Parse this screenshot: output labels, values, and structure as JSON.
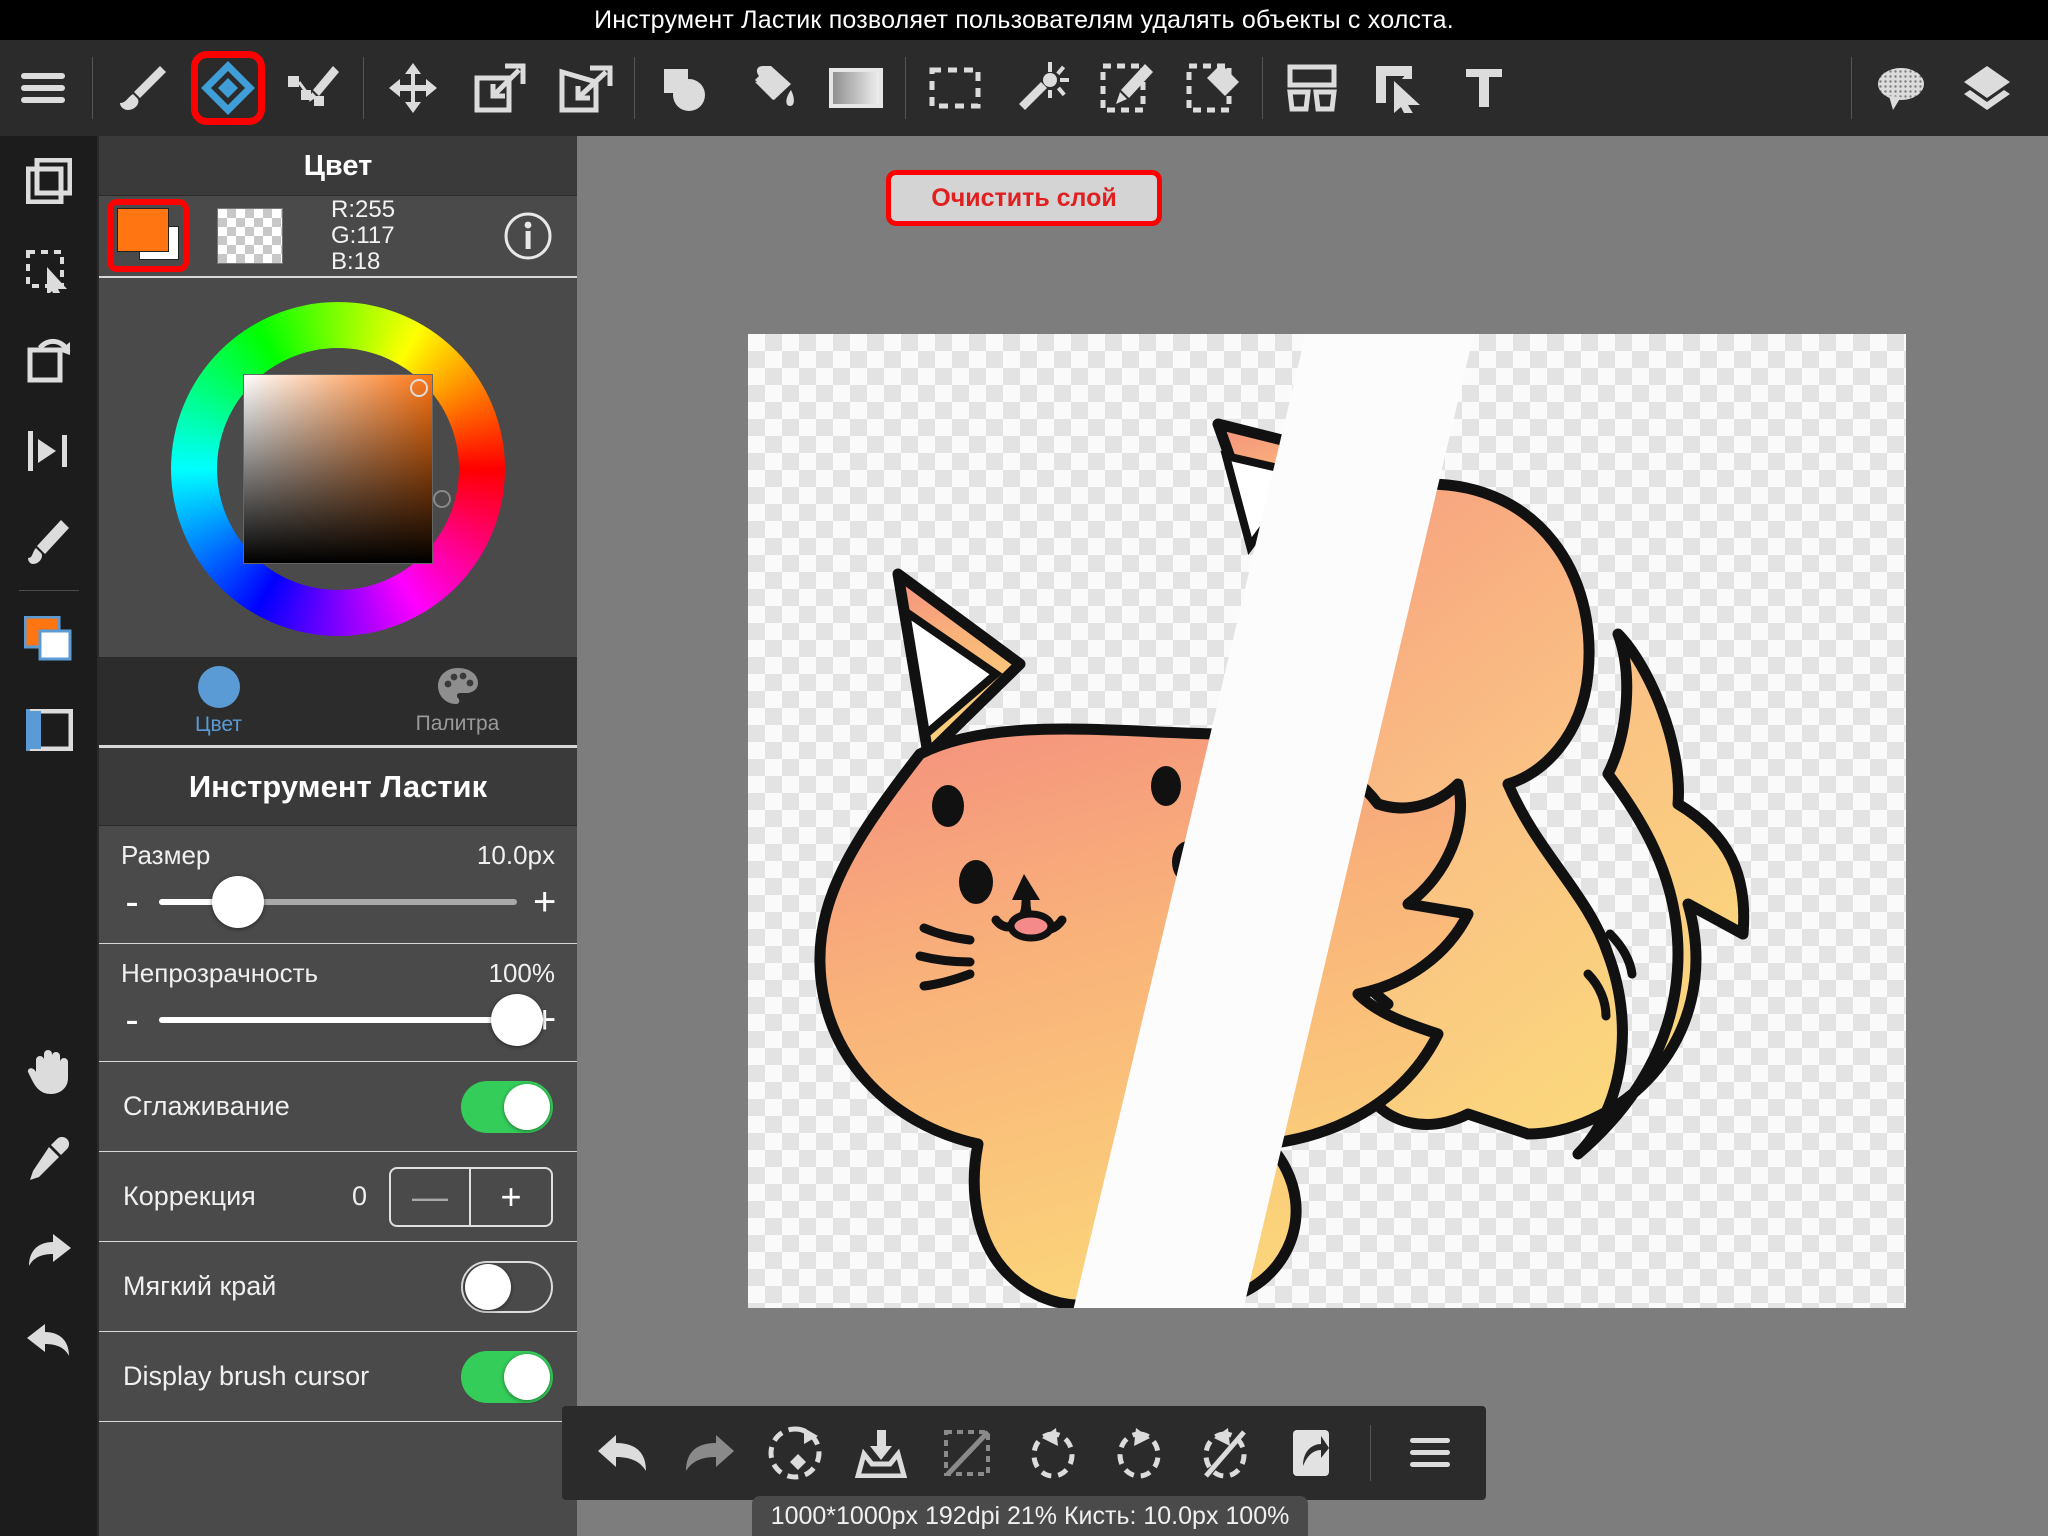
{
  "banner": {
    "text": "Инструмент Ластик позволяет пользователям удалять объекты с холста."
  },
  "toolbar": {
    "menu": "menu-icon",
    "items": [
      {
        "name": "brush-tool",
        "label": "Кисть"
      },
      {
        "name": "eraser-tool",
        "label": "Ластик",
        "selected": true
      },
      {
        "name": "pen-tool",
        "label": "Перо"
      },
      {
        "name": "move-tool",
        "label": "Перемещение"
      },
      {
        "name": "transform-tool",
        "label": "Трансформация"
      },
      {
        "name": "distort-tool",
        "label": "Искажение"
      },
      {
        "name": "shape-tool",
        "label": "Фигура"
      },
      {
        "name": "bucket-fill-tool",
        "label": "Заливка"
      },
      {
        "name": "gradient-tool",
        "label": "Градиент"
      },
      {
        "name": "rect-select-tool",
        "label": "Выделение"
      },
      {
        "name": "magic-wand-tool",
        "label": "Волшебная палочка"
      },
      {
        "name": "select-pen-tool",
        "label": "Выделение пером"
      },
      {
        "name": "select-eraser-tool",
        "label": "Ластик выделения"
      },
      {
        "name": "canvas-layout-tool",
        "label": "Холст"
      },
      {
        "name": "object-select-tool",
        "label": "Объект"
      },
      {
        "name": "text-tool",
        "label": "T"
      },
      {
        "name": "comment-tool",
        "label": "Комментарий"
      },
      {
        "name": "layers-tool",
        "label": "Слои"
      }
    ]
  },
  "rail": {
    "items": [
      {
        "name": "layers-panel",
        "label": "Слои"
      },
      {
        "name": "selection-panel",
        "label": "Выделение"
      },
      {
        "name": "rotate-panel",
        "label": "Поворот"
      },
      {
        "name": "flip-panel",
        "label": "Отражение"
      },
      {
        "name": "brush-panel",
        "label": "Кисть"
      },
      {
        "name": "color-panel",
        "label": "Цвет"
      },
      {
        "name": "window-panel",
        "label": "Окно"
      },
      {
        "name": "hand-tool",
        "label": "Рука"
      },
      {
        "name": "eyedropper-tool",
        "label": "Пипетка"
      },
      {
        "name": "redo-rail",
        "label": "Вперёд"
      },
      {
        "name": "undo-rail",
        "label": "Назад"
      }
    ]
  },
  "color_panel": {
    "title": "Цвет",
    "rgb": {
      "r": "R:255",
      "g": "G:117",
      "b": "B:18"
    },
    "foreground_hex": "#ff7512",
    "info_icon": "info-icon",
    "tabs": [
      {
        "name": "tab-color",
        "label": "Цвет",
        "active": true
      },
      {
        "name": "tab-palette",
        "label": "Палитра",
        "active": false
      }
    ]
  },
  "tool_panel": {
    "title": "Инструмент Ластик",
    "size": {
      "label": "Размер",
      "value": "10.0px",
      "percent": 22,
      "minus": "-",
      "plus": "+"
    },
    "opacity": {
      "label": "Непрозрачность",
      "value": "100%",
      "percent": 100,
      "minus": "-",
      "plus": "+"
    },
    "antialias": {
      "label": "Сглаживание",
      "state": "on"
    },
    "correction": {
      "label": "Коррекция",
      "value": "0",
      "minus": "—",
      "plus": "+"
    },
    "soft_edge": {
      "label": "Мягкий край",
      "state": "off"
    },
    "brush_cursor": {
      "label": "Display brush cursor",
      "state": "on"
    }
  },
  "canvas": {
    "clear_layer_button": "Очистить слой",
    "accent_red": "#ff0000",
    "artwork": "orange-cat-illustration"
  },
  "bottom_toolbar": {
    "items": [
      {
        "name": "undo-button",
        "label": "Отменить"
      },
      {
        "name": "redo-button",
        "label": "Повторить"
      },
      {
        "name": "flip-canvas-button",
        "label": "Отразить"
      },
      {
        "name": "import-button",
        "label": "Импорт"
      },
      {
        "name": "deselect-button",
        "label": "Снять выделение"
      },
      {
        "name": "rotate-left-button",
        "label": "Повернуть влево"
      },
      {
        "name": "rotate-right-button",
        "label": "Повернуть вправо"
      },
      {
        "name": "reset-rotation-button",
        "label": "Сброс поворота"
      },
      {
        "name": "share-button",
        "label": "Поделиться"
      },
      {
        "name": "more-menu-button",
        "label": "Ещё"
      }
    ]
  },
  "status_bar": {
    "text": "1000*1000px 192dpi 21% Кисть: 10.0px 100%"
  }
}
